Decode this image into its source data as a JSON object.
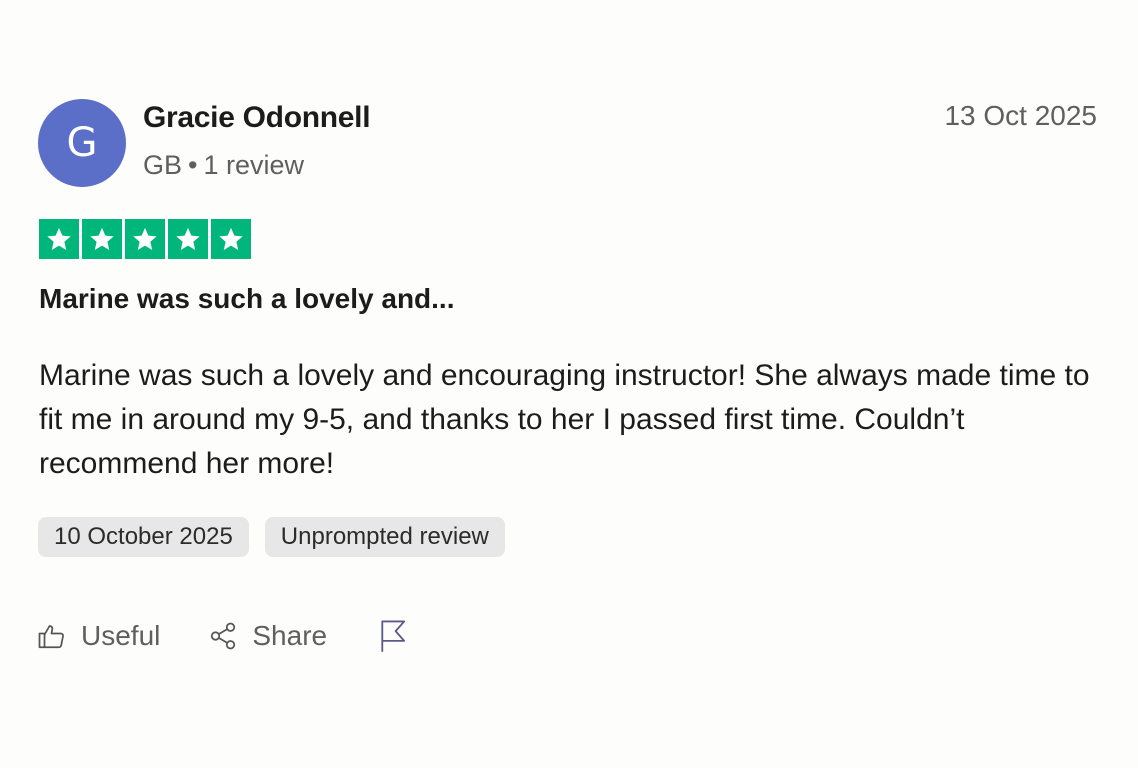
{
  "reviewer": {
    "initial": "G",
    "name": "Gracie Odonnell",
    "country": "GB",
    "separator": "•",
    "review_count": "1 review",
    "avatar_color": "#5b6ec8"
  },
  "review": {
    "date": "13 Oct 2025",
    "rating": 5,
    "rating_max": 5,
    "star_color": "#00b67a",
    "title": "Marine was such a lovely and...",
    "body": "Marine was such a lovely and encouraging instructor! She always made time to fit me in around my 9-5, and thanks to her I passed first time. Couldn’t recommend her more!",
    "experience_date": "10 October 2025",
    "source_tag": "Unprompted review"
  },
  "actions": {
    "useful_label": "Useful",
    "useful_icon": "thumbs-up-icon",
    "share_label": "Share",
    "share_icon": "share-icon",
    "report_icon": "flag-icon"
  }
}
